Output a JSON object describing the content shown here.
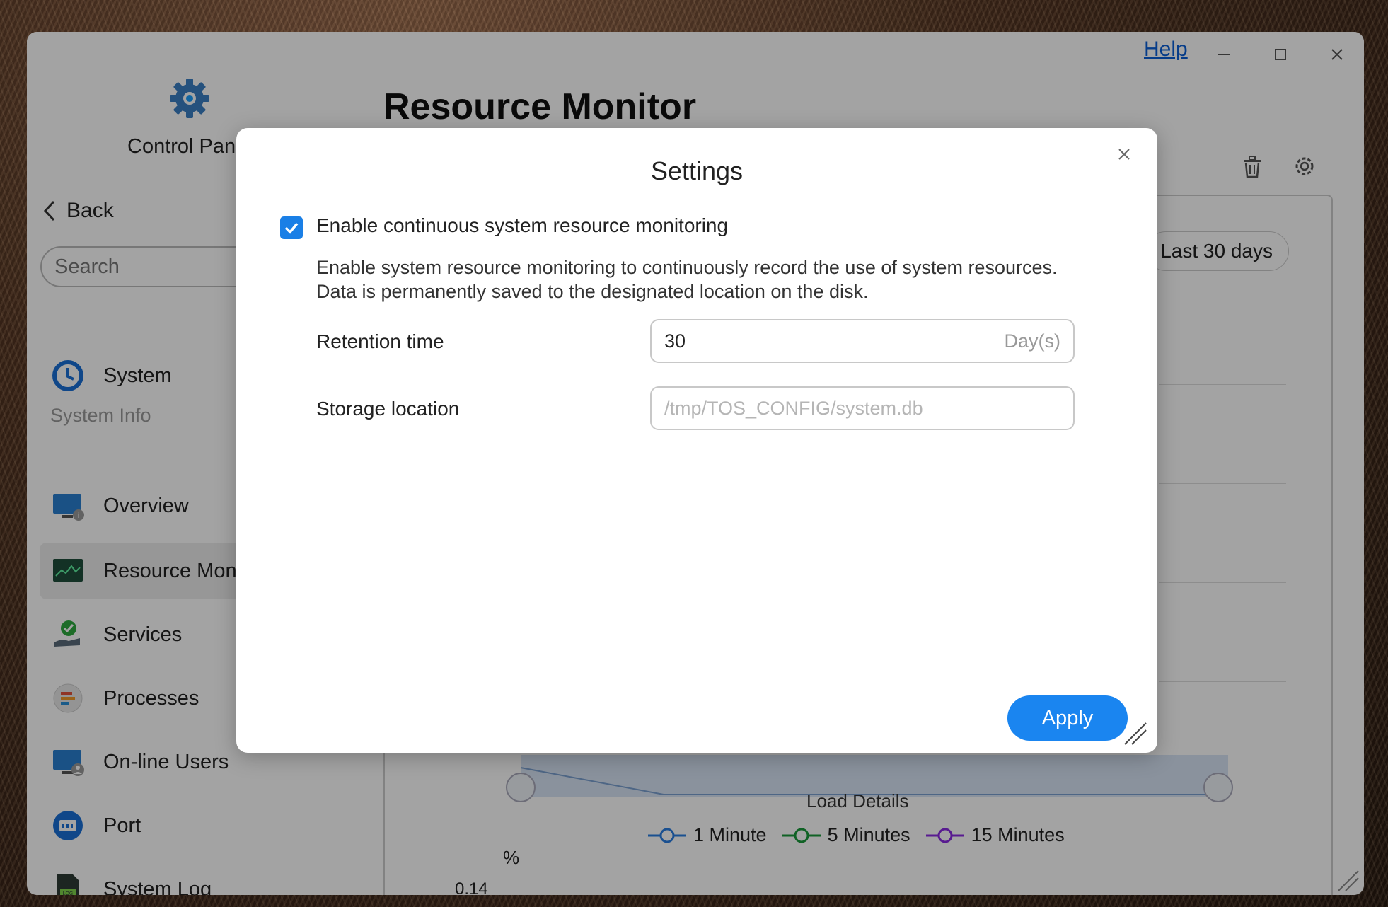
{
  "window": {
    "help_label": "Help",
    "controls": {
      "minimize": "−",
      "maximize": "□",
      "close": "×"
    }
  },
  "sidebar": {
    "app_name": "Control Panel",
    "back_label": "Back",
    "search_placeholder": "Search",
    "section_label": "System Info",
    "items": [
      {
        "label": "System",
        "icon": "system-icon"
      },
      {
        "label": "Overview",
        "icon": "overview-icon"
      },
      {
        "label": "Resource Monitor",
        "icon": "resource-monitor-icon",
        "active": true
      },
      {
        "label": "Services",
        "icon": "services-icon"
      },
      {
        "label": "Processes",
        "icon": "processes-icon"
      },
      {
        "label": "On-line Users",
        "icon": "online-users-icon"
      },
      {
        "label": "Port",
        "icon": "port-icon"
      },
      {
        "label": "System Log",
        "icon": "system-log-icon"
      }
    ]
  },
  "main": {
    "title": "Resource Monitor",
    "range_label": "Last 30 days",
    "load_title": "Load Details",
    "legend": [
      {
        "label": "1 Minute",
        "color": "#2a7de1"
      },
      {
        "label": "5 Minutes",
        "color": "#1a9a3a"
      },
      {
        "label": "15 Minutes",
        "color": "#8a2be2"
      }
    ],
    "unit_label": "%",
    "tick_first": "0.14"
  },
  "modal": {
    "title": "Settings",
    "checkbox_label": "Enable continuous system resource monitoring",
    "checkbox_checked": true,
    "description": "Enable system resource monitoring to continuously record the use of system resources. Data is permanently saved to the designated location on the disk.",
    "retention": {
      "label": "Retention time",
      "value": "30",
      "unit": "Day(s)"
    },
    "storage": {
      "label": "Storage location",
      "value": "/tmp/TOS_CONFIG/system.db"
    },
    "apply_label": "Apply"
  },
  "colors": {
    "accent": "#1a85f0",
    "link": "#0a5fd6"
  }
}
